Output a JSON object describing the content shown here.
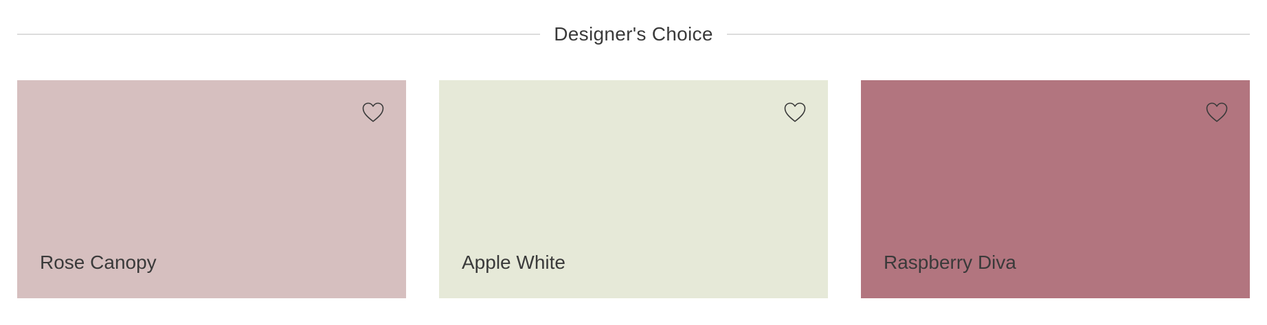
{
  "section": {
    "title": "Designer's Choice"
  },
  "colors": {
    "rule": "#dcdcdc",
    "text": "#3a3a3a"
  },
  "cards": [
    {
      "name": "Rose Canopy",
      "swatch": "#d6bfbf",
      "icon": "heart-outline-icon"
    },
    {
      "name": "Apple White",
      "swatch": "#e6e9d8",
      "icon": "heart-outline-icon"
    },
    {
      "name": "Raspberry Diva",
      "swatch": "#b2757f",
      "icon": "heart-outline-icon"
    }
  ]
}
